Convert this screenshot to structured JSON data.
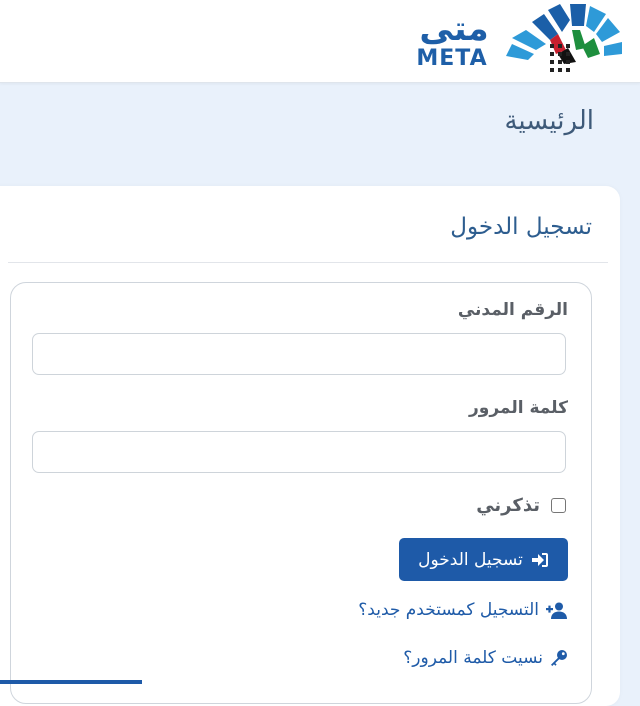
{
  "header": {
    "logo_arabic": "متى",
    "logo_english": "META"
  },
  "page": {
    "title": "الرئيسية"
  },
  "login": {
    "card_title": "تسجيل الدخول",
    "civil_id_label": "الرقم المدني",
    "civil_id_value": "",
    "password_label": "كلمة المرور",
    "password_value": "",
    "remember_label": "تذكرني",
    "remember_checked": false,
    "submit_label": "تسجيل الدخول",
    "register_link": "التسجيل كمستخدم جديد؟",
    "forgot_link": "نسيت كلمة المرور؟"
  },
  "icons": {
    "submit": "sign-in-icon",
    "register": "user-plus-icon",
    "forgot": "key-icon"
  },
  "colors": {
    "primary": "#1e5aa8",
    "page_background": "#e9f1fb",
    "title_text": "#3e5a79",
    "label_text": "#5a5f66"
  }
}
